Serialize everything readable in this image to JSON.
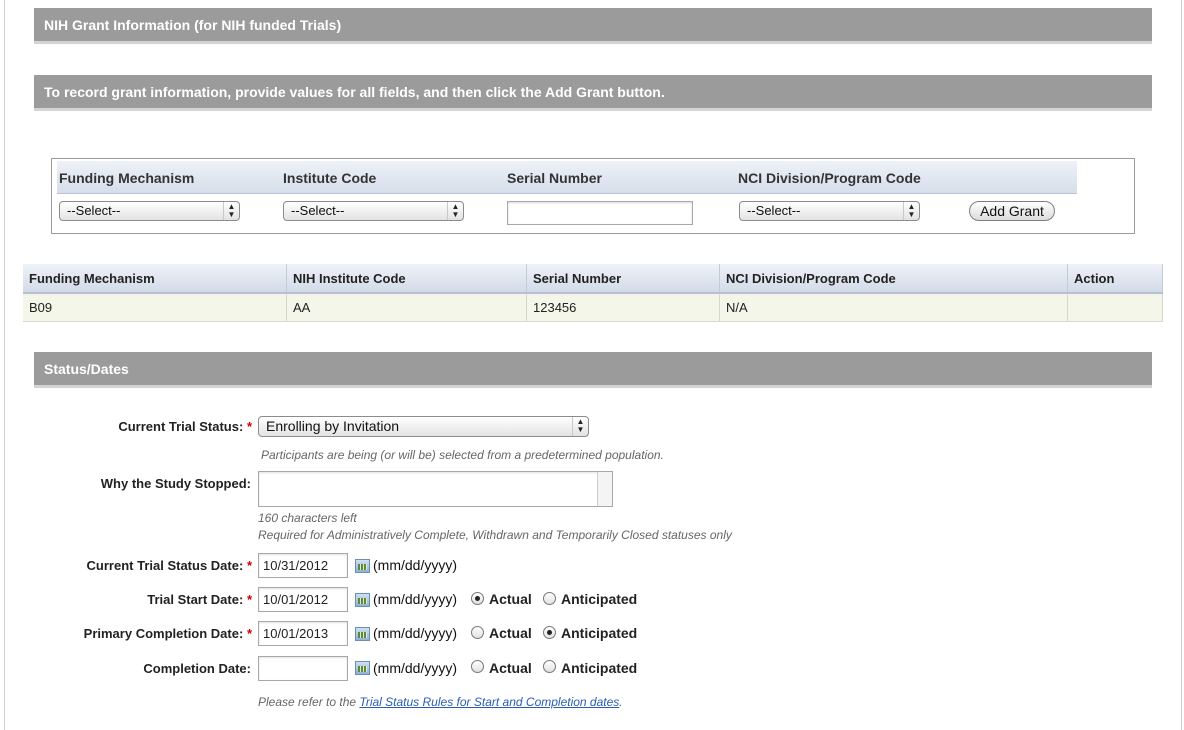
{
  "nih_section": {
    "title": "NIH Grant Information (for NIH funded Trials)",
    "instruction": "To record grant information, provide values for all fields, and then click the Add Grant button."
  },
  "grant_form": {
    "headers": {
      "funding_mechanism": "Funding Mechanism",
      "institute_code": "Institute Code",
      "serial_number": "Serial Number",
      "nci_division": "NCI Division/Program Code"
    },
    "funding_mechanism_value": "--Select--",
    "institute_code_value": "--Select--",
    "serial_number_value": "",
    "nci_division_value": "--Select--",
    "add_button": "Add Grant"
  },
  "grant_table": {
    "headers": [
      "Funding Mechanism",
      "NIH Institute Code",
      "Serial Number",
      "NCI Division/Program Code",
      "Action"
    ],
    "rows": [
      [
        "B09",
        "AA",
        "123456",
        "N/A",
        ""
      ]
    ]
  },
  "status_section": {
    "title": "Status/Dates",
    "current_status_label": "Current Trial Status:",
    "current_status_value": "Enrolling by Invitation",
    "current_status_hint": "Participants are being (or will be) selected from a predetermined population.",
    "why_stopped_label": "Why the Study Stopped:",
    "chars_left": "160 characters left",
    "why_stopped_hint": "Required for Administratively Complete, Withdrawn and Temporarily Closed statuses only",
    "required_mark": "*",
    "date_format": "(mm/dd/yyyy)",
    "actual_label": "Actual",
    "anticipated_label": "Anticipated",
    "status_date_label": "Current Trial Status Date:",
    "status_date_value": "10/31/2012",
    "start_date_label": "Trial Start Date:",
    "start_date_value": "10/01/2012",
    "primary_completion_label": "Primary Completion Date:",
    "primary_completion_value": "10/01/2013",
    "completion_label": "Completion Date:",
    "completion_value": "",
    "note_prefix": "Please refer to the ",
    "note_link": "Trial Status Rules for Start and Completion dates",
    "note_suffix": "."
  }
}
